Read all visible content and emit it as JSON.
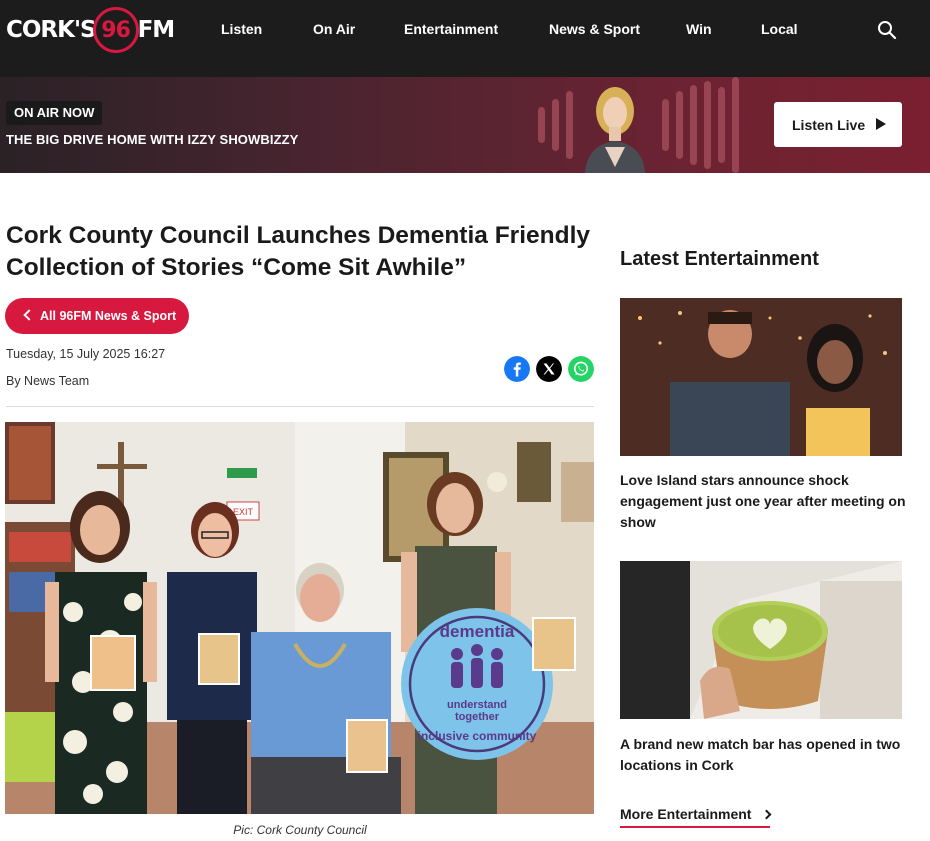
{
  "brand": {
    "logo_part1": "CORK'S",
    "logo_part2": "96",
    "logo_part3": "FM",
    "accent": "#d7193f"
  },
  "nav": {
    "items": [
      "Listen",
      "On Air",
      "Entertainment",
      "News & Sport",
      "Win",
      "Local"
    ],
    "search_icon": "search-icon"
  },
  "on_air": {
    "badge": "ON AIR NOW",
    "show": "THE BIG DRIVE HOME WITH IZZY SHOWBIZZY",
    "listen_label": "Listen Live"
  },
  "article": {
    "title": "Cork County Council Launches Dementia Friendly Collection of Stories “Come Sit Awhile”",
    "back_label": "All 96FM News & Sport",
    "date": "Tuesday, 15 July 2025 16:27",
    "byline": "By News Team",
    "share_icons": [
      "facebook-icon",
      "x-icon",
      "whatsapp-icon"
    ],
    "photo_sign_top": "dementia",
    "photo_sign_mid1": "understand",
    "photo_sign_mid2": "together",
    "photo_sign_bottom": "inclusive community",
    "photo_exit_sign": "EXIT",
    "caption": "Pic: Cork County Council"
  },
  "sidebar": {
    "title": "Latest Entertainment",
    "cards": [
      {
        "title": "Love Island stars announce shock engagement just one year after meeting on show"
      },
      {
        "title": "A brand new match bar has opened in two locations in Cork"
      }
    ],
    "more_label": "More Entertainment"
  }
}
